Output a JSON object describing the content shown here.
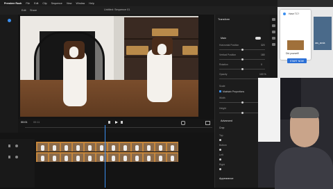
{
  "app": {
    "title": "Untitled: Sequence 01",
    "menu": [
      "Premiere Rush",
      "File",
      "Edit",
      "Clip",
      "Sequence",
      "View",
      "Window",
      "Help"
    ]
  },
  "toolbar": {
    "tabs": [
      "Edit",
      "Share"
    ]
  },
  "viewer": {
    "timecode_current": "00:01",
    "timecode_total": "00:11"
  },
  "properties": {
    "panel_title": "Transform",
    "section_main": "Main",
    "fields": [
      {
        "label": "Horizontal Position",
        "value": "320"
      },
      {
        "label": "Vertical Position",
        "value": "180"
      },
      {
        "label": "Rotation",
        "value": "0"
      },
      {
        "label": "Opacity",
        "value": "100 %"
      }
    ],
    "scale_label": "Scale",
    "maintain_label": "Maintain Proportions",
    "width_label": "Width",
    "height_label": "Height",
    "advanced_label": "Advanced",
    "crop_label": "Crop",
    "crop_fields": [
      "Top",
      "Bottom",
      "Left",
      "Right"
    ],
    "appearance_label": "Appearance"
  },
  "browser": {
    "popup_title": "Have TC?",
    "popup_text": "Did yourself!",
    "start_label": "START NOW",
    "thumb_label": "ass_acsta"
  },
  "colors": {
    "accent": "#3b8ff0",
    "clip": "#c6873c",
    "panel": "#1c1c1c"
  }
}
